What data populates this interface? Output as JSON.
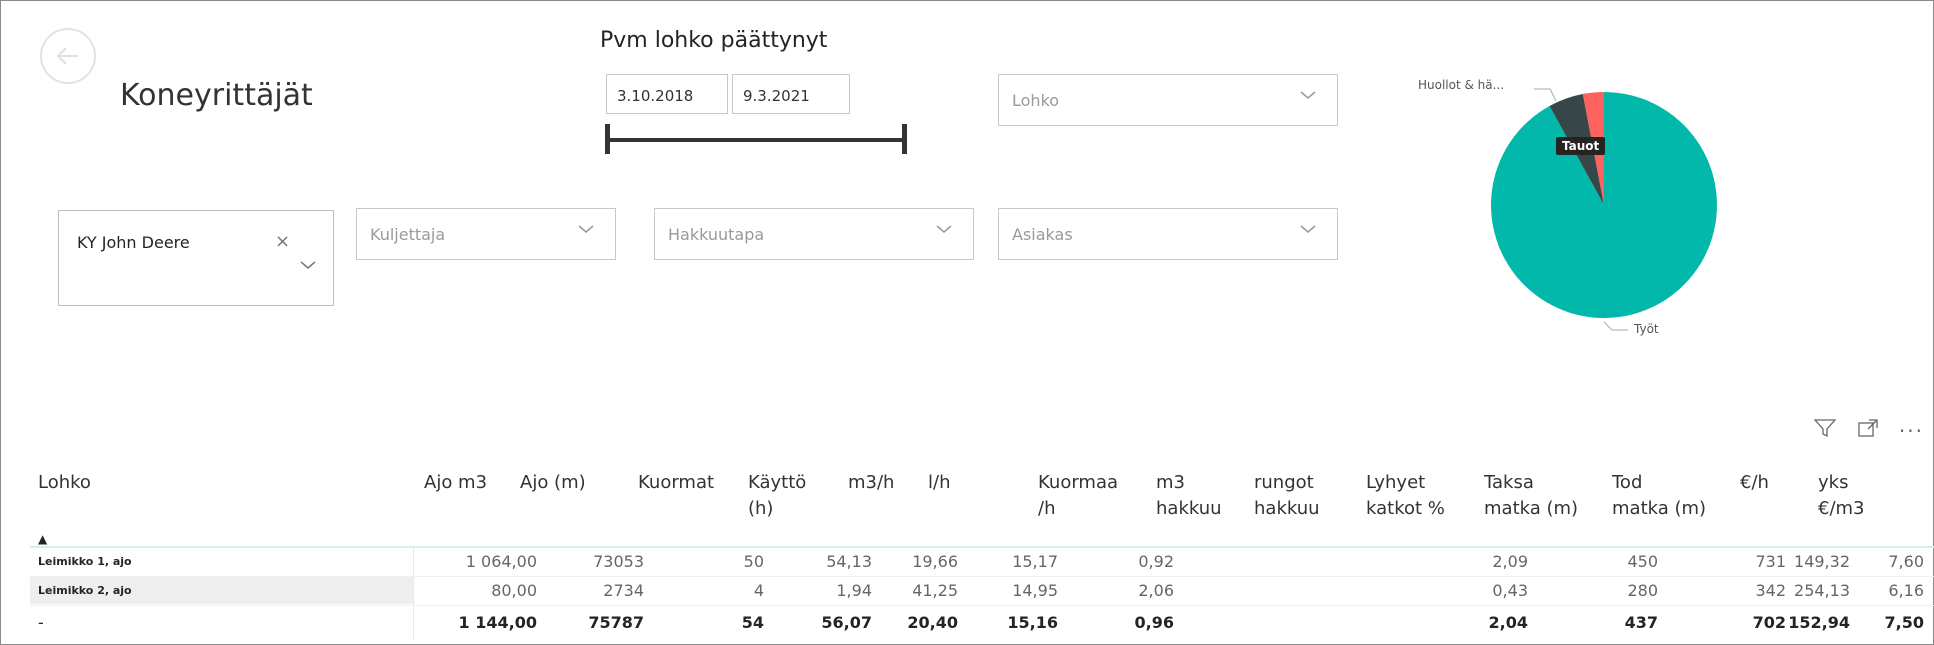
{
  "page": {
    "title": "Koneyrittäjät"
  },
  "date_filter": {
    "label": "Pvm lohko päättynyt",
    "start": "3.10.2018",
    "end": "9.3.2021"
  },
  "filters": {
    "lohko_placeholder": "Lohko",
    "ky_value": "KY John Deere",
    "kuljettaja_placeholder": "Kuljettaja",
    "hakkuutapa_placeholder": "Hakkuutapa",
    "asiakas_placeholder": "Asiakas"
  },
  "pie": {
    "label_huollot": "Huollot & hä...",
    "label_tauot": "Tauot",
    "label_tyot": "Työt",
    "colors": {
      "tyot": "#01b8aa",
      "huollot": "#374649",
      "tauot": "#fd625e"
    }
  },
  "chart_data": {
    "type": "pie",
    "slices": [
      {
        "name": "Työt",
        "value": 0.92
      },
      {
        "name": "Huollot & hä...",
        "value": 0.05
      },
      {
        "name": "Tauot",
        "value": 0.03
      }
    ]
  },
  "table": {
    "headers": [
      {
        "line1": "Lohko",
        "line2": ""
      },
      {
        "line1": "Ajo m3",
        "line2": ""
      },
      {
        "line1": "Ajo (m)",
        "line2": ""
      },
      {
        "line1": "Kuormat",
        "line2": ""
      },
      {
        "line1": "Käyttö",
        "line2": "(h)"
      },
      {
        "line1": "m3/h",
        "line2": ""
      },
      {
        "line1": "l/h",
        "line2": ""
      },
      {
        "line1": "Kuormaa",
        "line2": "/h"
      },
      {
        "line1": "m3",
        "line2": "hakkuu"
      },
      {
        "line1": "rungot",
        "line2": "hakkuu"
      },
      {
        "line1": "Lyhyet",
        "line2": "katkot %"
      },
      {
        "line1": "Taksa",
        "line2": "matka (m)"
      },
      {
        "line1": "Tod",
        "line2": "matka (m)"
      },
      {
        "line1": "€/h",
        "line2": ""
      },
      {
        "line1": "yks",
        "line2": "€/m3"
      }
    ],
    "rows": [
      {
        "label": "Leimikko 1, ajo",
        "cells": [
          "1 064,00",
          "73053",
          "50",
          "54,13",
          "19,66",
          "15,17",
          "0,92",
          "",
          "",
          "2,09",
          "450",
          "731",
          "149,32",
          "7,60"
        ]
      },
      {
        "label": "Leimikko 2, ajo",
        "cells": [
          "80,00",
          "2734",
          "4",
          "1,94",
          "41,25",
          "14,95",
          "2,06",
          "",
          "",
          "0,43",
          "280",
          "342",
          "254,13",
          "6,16"
        ]
      }
    ],
    "total": {
      "label": "-",
      "cells": [
        "1 144,00",
        "75787",
        "54",
        "56,07",
        "20,40",
        "15,16",
        "0,96",
        "",
        "",
        "2,04",
        "437",
        "702",
        "152,94",
        "7,50"
      ]
    }
  }
}
